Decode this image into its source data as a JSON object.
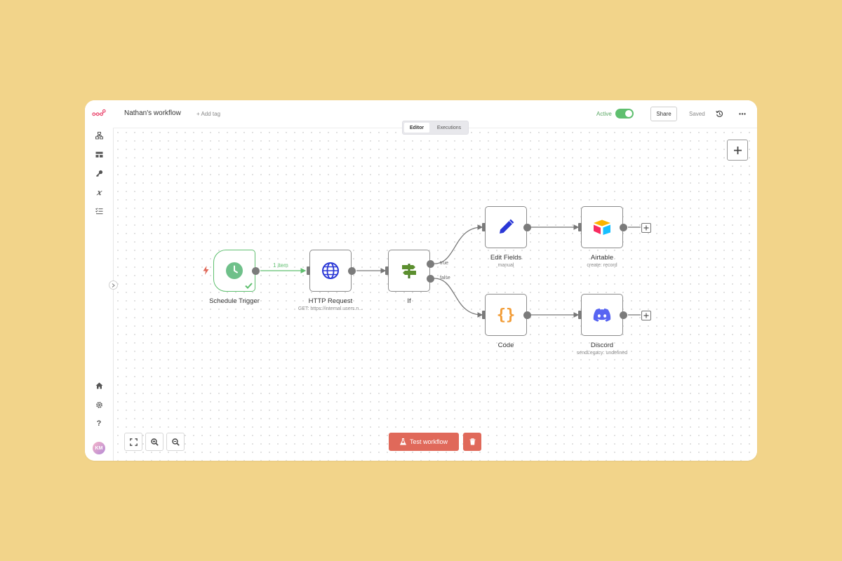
{
  "header": {
    "workflow_title": "Nathan's workflow",
    "add_tag": "+ Add tag",
    "active_label": "Active",
    "active": true,
    "share_label": "Share",
    "saved_label": "Saved"
  },
  "tabs": [
    {
      "label": "Editor",
      "selected": true
    },
    {
      "label": "Executions",
      "selected": false
    }
  ],
  "sidebar": {
    "items": [
      {
        "icon": "workflows-icon"
      },
      {
        "icon": "templates-icon"
      },
      {
        "icon": "credentials-icon"
      },
      {
        "icon": "variables-icon"
      },
      {
        "icon": "executions-list-icon"
      }
    ],
    "bottom_items": [
      {
        "icon": "home-icon"
      },
      {
        "icon": "settings-gear-icon"
      },
      {
        "icon": "help-icon"
      }
    ],
    "avatar_initials": "KM"
  },
  "nodes": {
    "schedule_trigger": {
      "label": "Schedule Trigger",
      "subtitle": ""
    },
    "http_request": {
      "label": "HTTP Request",
      "subtitle": "GET: https://internal.users.n..."
    },
    "if": {
      "label": "If",
      "subtitle": ""
    },
    "edit_fields": {
      "label": "Edit Fields",
      "subtitle": "manual"
    },
    "airtable": {
      "label": "Airtable",
      "subtitle": "create: record"
    },
    "code": {
      "label": "Code",
      "subtitle": ""
    },
    "discord": {
      "label": "Discord",
      "subtitle": "sendLegacy: undefined"
    }
  },
  "edges": {
    "trigger_to_http_count": "1 item",
    "if_true": "true",
    "if_false": "false"
  },
  "footer": {
    "test_workflow_label": "Test workflow"
  },
  "colors": {
    "accent": "#e0695a",
    "success": "#5fbf6f",
    "brand": "#ea4b71"
  }
}
